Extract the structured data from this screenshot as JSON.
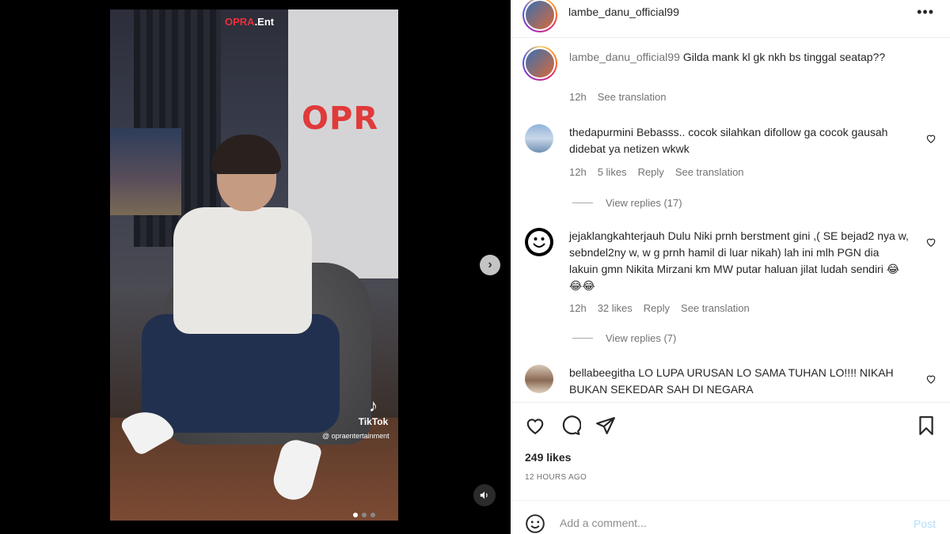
{
  "media": {
    "watermark_prefix": "OPRA",
    "watermark_suffix": ".Ent",
    "sign_text": "OPR",
    "tiktok_label": "TikTok",
    "tiktok_handle": "@ opraentertainment",
    "slide_count": 3,
    "active_slide": 1
  },
  "post": {
    "author": "lambe_danu_official99",
    "caption_user": "lambe_danu_official99",
    "caption_text": "Gilda mank kl gk nkh bs tinggal seatap??",
    "caption_time": "12h",
    "caption_translate": "See translation",
    "likes": "249 likes",
    "timestamp": "12 HOURS AGO"
  },
  "comments": [
    {
      "user": "thedapurmini",
      "text": "Bebasss.. cocok silahkan difollow ga cocok gausah didebat ya netizen wkwk",
      "time": "12h",
      "likes": "5 likes",
      "reply": "Reply",
      "translate": "See translation",
      "view_replies": "View replies (17)"
    },
    {
      "user": "jejaklangkahterjauh",
      "text": "Dulu Niki prnh berstment gini ,( SE bejad2 nya w, sebndel2ny w, w g prnh hamil di luar nikah) lah ini mlh PGN dia lakuin gmn Nikita Mirzani km MW putar haluan jilat ludah sendiri 😂😂😂",
      "time": "12h",
      "likes": "32 likes",
      "reply": "Reply",
      "translate": "See translation",
      "view_replies": "View replies (7)"
    },
    {
      "user": "bellabeegitha",
      "text": "LO LUPA URUSAN LO SAMA TUHAN LO!!!! NIKAH BUKAN SEKEDAR SAH DI NEGARA"
    }
  ],
  "composer": {
    "placeholder": "Add a comment...",
    "post_label": "Post"
  },
  "icons": {
    "more": "more-horizontal-icon",
    "next": "chevron-right-icon",
    "audio": "speaker-icon",
    "like": "heart-icon",
    "comment": "comment-bubble-icon",
    "share": "paper-plane-icon",
    "save": "bookmark-icon",
    "emoji": "smiley-icon"
  },
  "colors": {
    "post_button": "#b2dffc",
    "muted_text": "#737373",
    "text": "#262626"
  }
}
